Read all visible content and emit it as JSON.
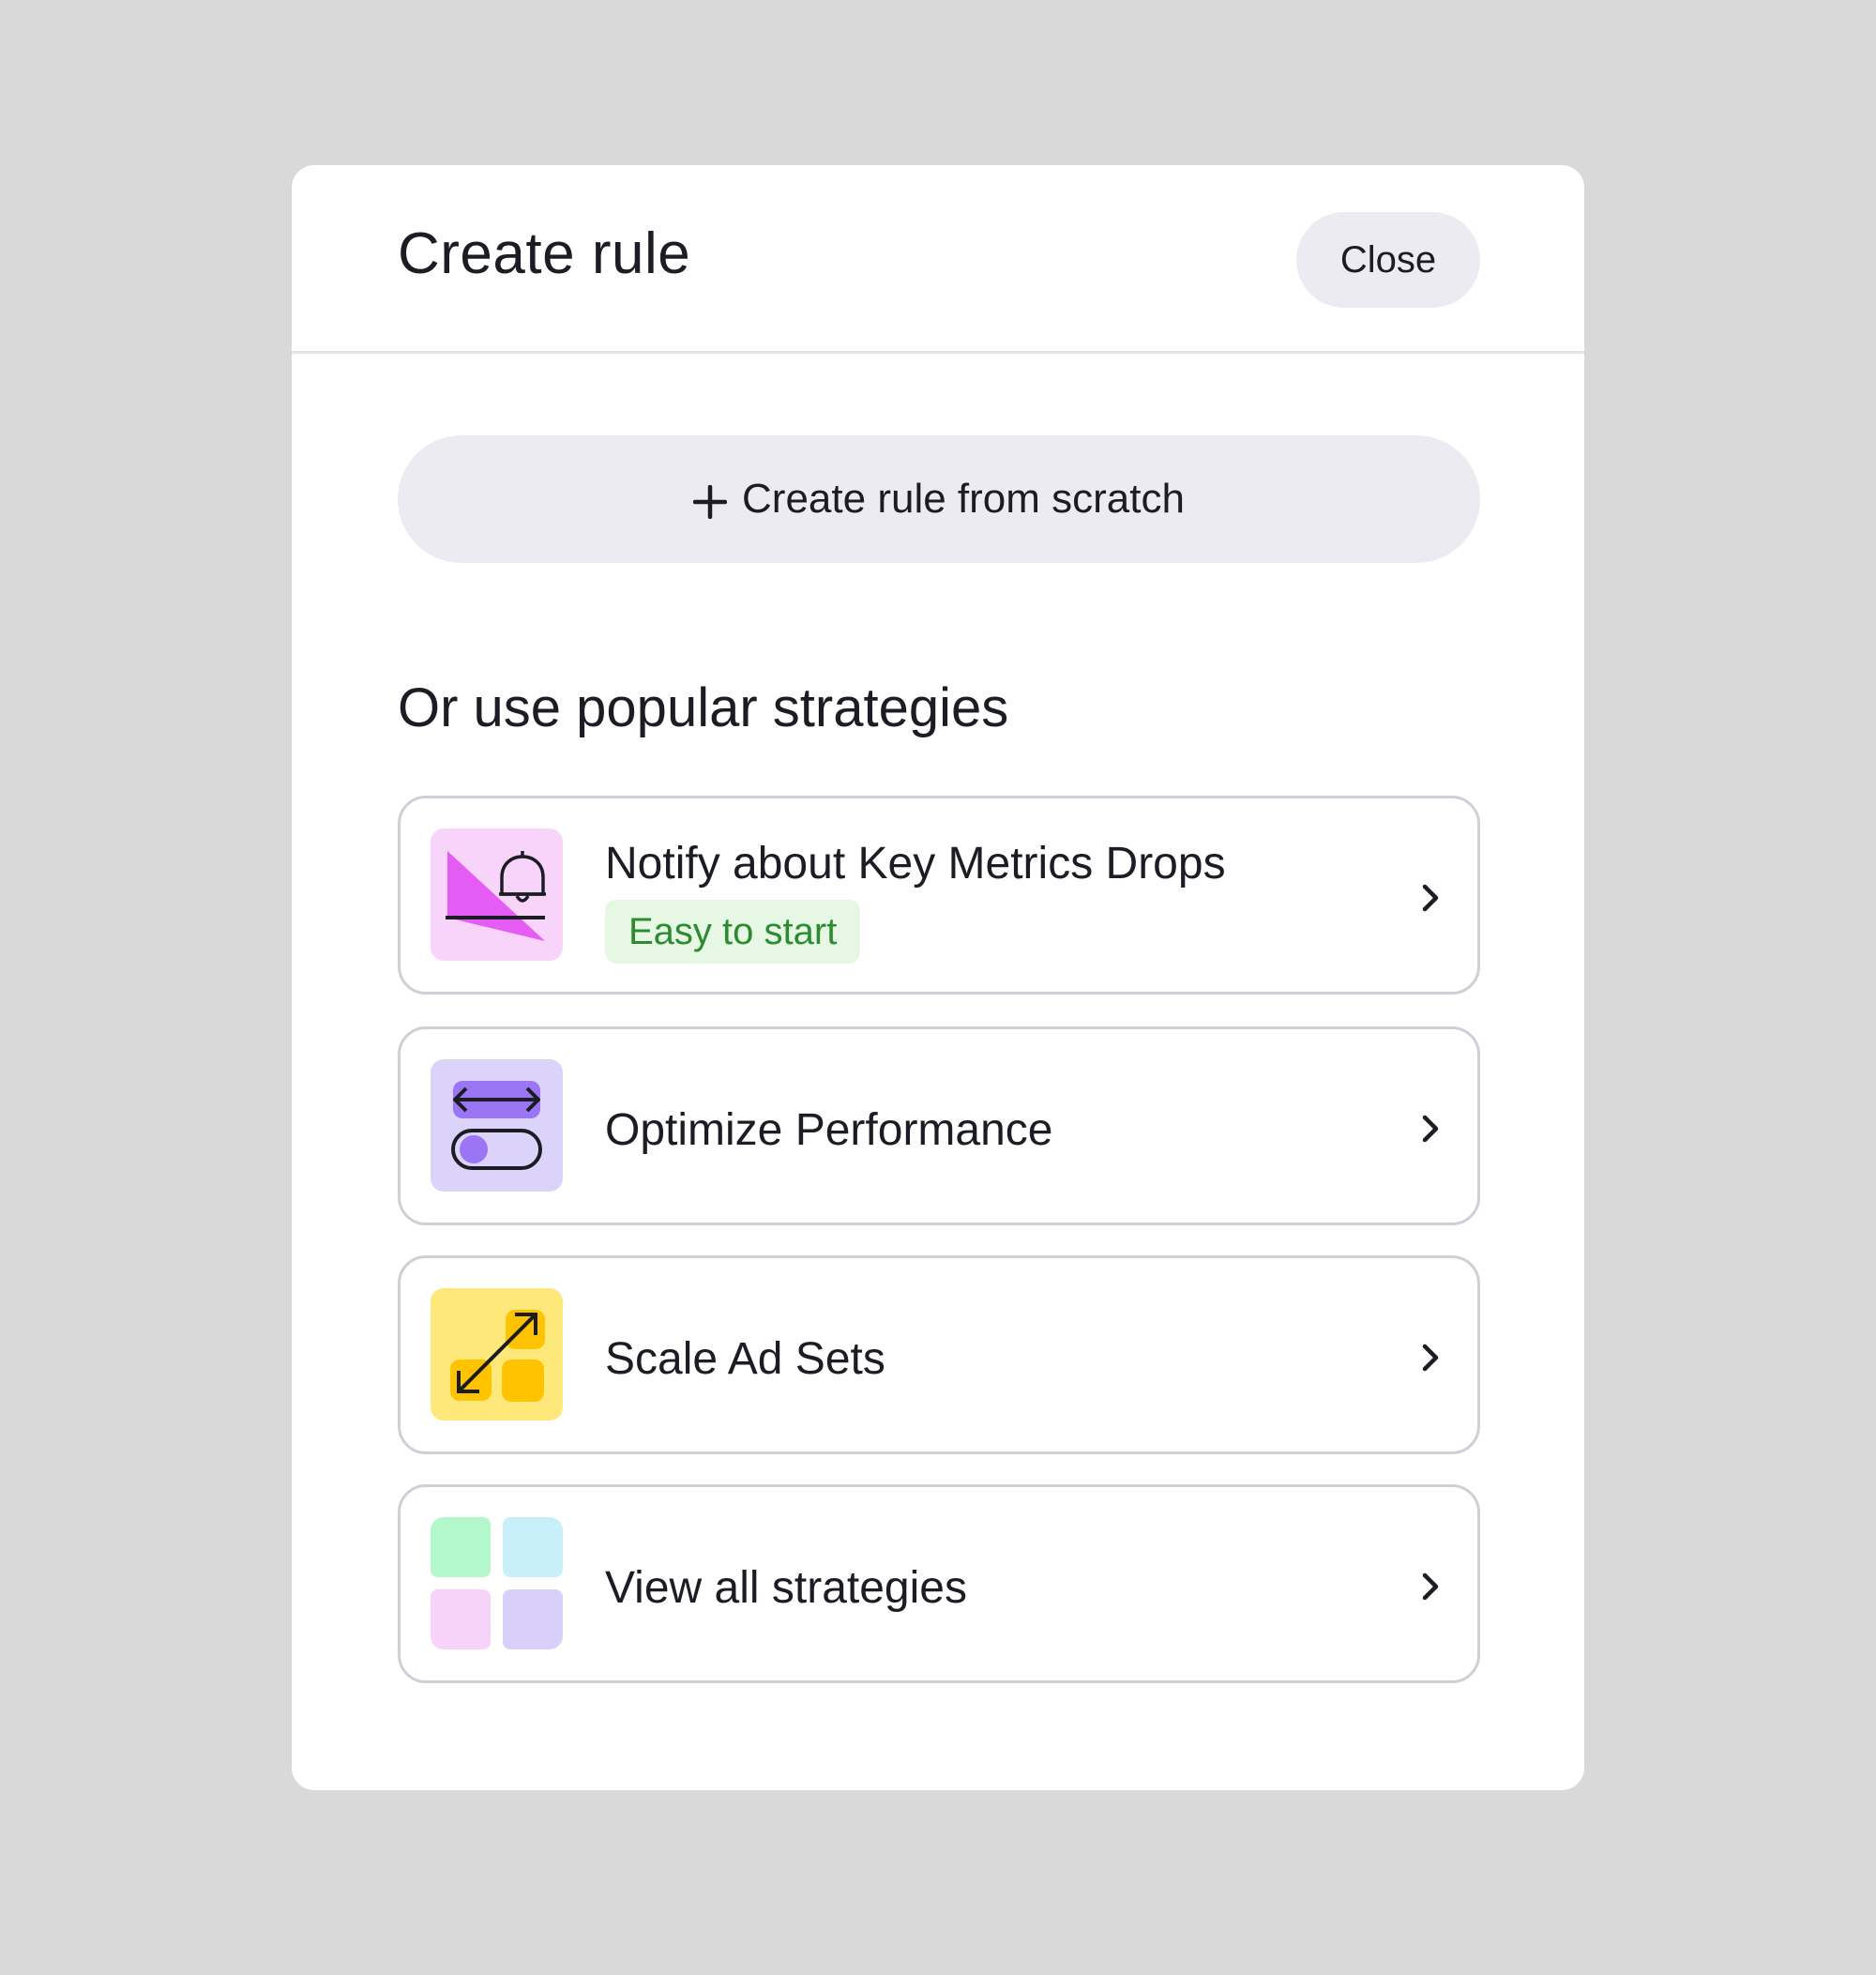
{
  "dialog": {
    "title": "Create rule",
    "close_label": "Close"
  },
  "create_button": {
    "icon": "plus-icon",
    "label": "Create rule from scratch"
  },
  "strategies": {
    "heading": "Or use popular strategies",
    "items": [
      {
        "title": "Notify about Key Metrics Drops",
        "badge": "Easy to start",
        "icon": "metrics-drop-bell-icon",
        "icon_bg": "#f8d3fa",
        "accent": "#e55cf5"
      },
      {
        "title": "Optimize Performance",
        "icon": "optimize-toggle-icon",
        "icon_bg": "#dcd3fb",
        "accent": "#9a76f5"
      },
      {
        "title": "Scale Ad Sets",
        "icon": "scale-arrow-icon",
        "icon_bg": "#fde879",
        "accent": "#ffc300"
      },
      {
        "title": "View all strategies",
        "icon": "grid-tiles-icon",
        "tile_colors": [
          "#b3f8cd",
          "#c7f0fb",
          "#f7d3f9",
          "#d8d0fb"
        ]
      }
    ]
  },
  "colors": {
    "backdrop": "#d9d9d9",
    "surface": "#ffffff",
    "button_bg": "#ecebf2",
    "text": "#1c1c24",
    "badge_bg": "#e6f8e4",
    "badge_text": "#2c8a30",
    "card_border": "#cfcfd8"
  }
}
